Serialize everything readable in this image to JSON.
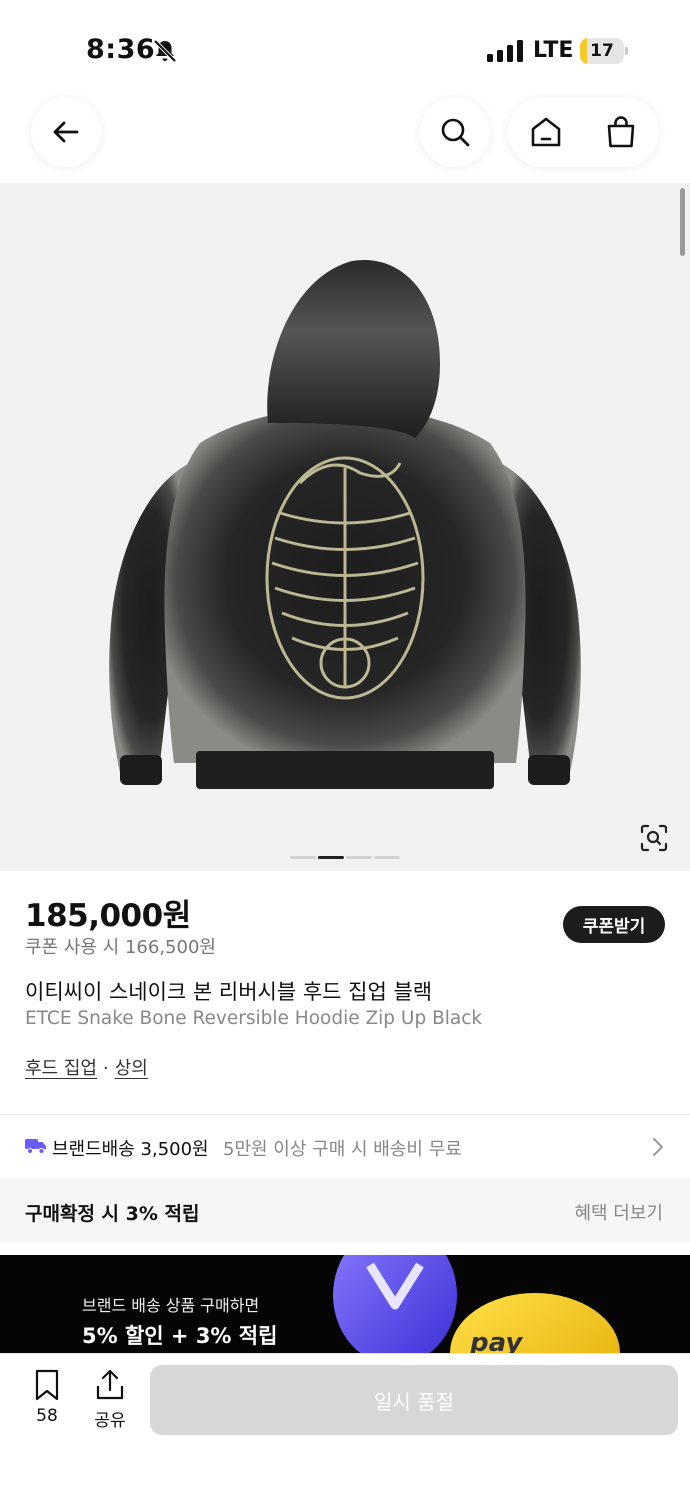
{
  "status_bar": {
    "time": "8:36",
    "network": "LTE",
    "battery_level": "17",
    "battery_fraction": 0.17,
    "battery_color": "#f6cb27"
  },
  "nav": {
    "back_icon": "arrow-left-icon",
    "search_icon": "search-icon",
    "home_icon": "home-icon",
    "cart_icon": "shopping-bag-icon"
  },
  "gallery": {
    "image_subject": "black snake-bone reversible hoodie, back view",
    "dots_total": 4,
    "active_index": 1,
    "lens_icon": "visual-search-icon"
  },
  "product": {
    "price": "185,000원",
    "coupon_price": "쿠폰 사용 시 166,500원",
    "coupon_button": "쿠폰받기",
    "name_ko": "이티씨이 스네이크 본 리버시블 후드 집업 블랙",
    "name_en": "ETCE Snake Bone Reversible Hoodie Zip Up Black",
    "category": "후드 집업",
    "category_separator": "·",
    "parent_category": "상의"
  },
  "shipping": {
    "icon": "truck-icon",
    "icon_color": "#6a5cff",
    "label": "브랜드배송 3,500원",
    "note": "5만원 이상 구매 시 배송비 무료"
  },
  "points": {
    "label": "구매확정 시 3% 적립",
    "link": "혜택 더보기"
  },
  "banner": {
    "line1": "브랜드 배송 상품 구매하면",
    "line2": "5% 할인 + 3% 적립",
    "coin_text": "pay"
  },
  "bottom_bar": {
    "wishlist_icon": "bookmark-icon",
    "wishlist_count": "58",
    "share_icon": "share-icon",
    "share_label": "공유",
    "buy_button": "일시 품절"
  }
}
